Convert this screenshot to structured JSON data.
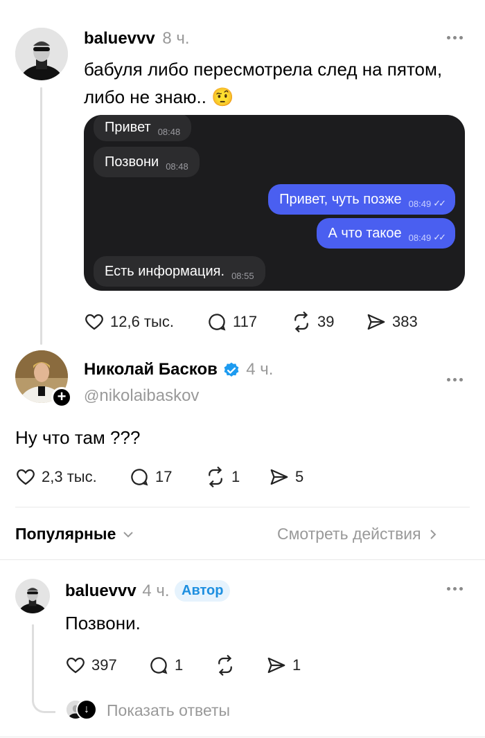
{
  "post1": {
    "username": "baluevvv",
    "time": "8 ч.",
    "text_line1": "бабуля либо пересмотрела след на пятом,",
    "text_line2": "либо не знаю..",
    "emoji": "🤨",
    "chat": {
      "messages": [
        {
          "text": "Привет",
          "time": "08:48",
          "dir": "in"
        },
        {
          "text": "Позвони",
          "time": "08:48",
          "dir": "in"
        },
        {
          "text": "Привет, чуть позже",
          "time": "08:49",
          "dir": "out"
        },
        {
          "text": "А что такое",
          "time": "08:49",
          "dir": "out"
        },
        {
          "text": "Есть информация.",
          "time": "08:55",
          "dir": "in"
        }
      ]
    },
    "likes": "12,6 тыс.",
    "comments": "117",
    "reposts": "39",
    "shares": "383"
  },
  "post2": {
    "username": "Николай Басков",
    "time": "4 ч.",
    "handle": "nikolaibaskov",
    "text": "Ну что там ???",
    "likes": "2,3 тыс.",
    "comments": "17",
    "reposts": "1",
    "shares": "5"
  },
  "sort": {
    "label": "Популярные",
    "view_activity": "Смотреть действия"
  },
  "reply": {
    "username": "baluevvv",
    "time": "4 ч.",
    "badge": "Автор",
    "text": "Позвони.",
    "likes": "397",
    "comments": "1",
    "shares": "1",
    "show_replies": "Показать ответы"
  },
  "colors": {
    "accent_blue": "#1d9bf0",
    "bubble_out": "#4a5ff0",
    "chat_bg": "#1c1c1e"
  }
}
